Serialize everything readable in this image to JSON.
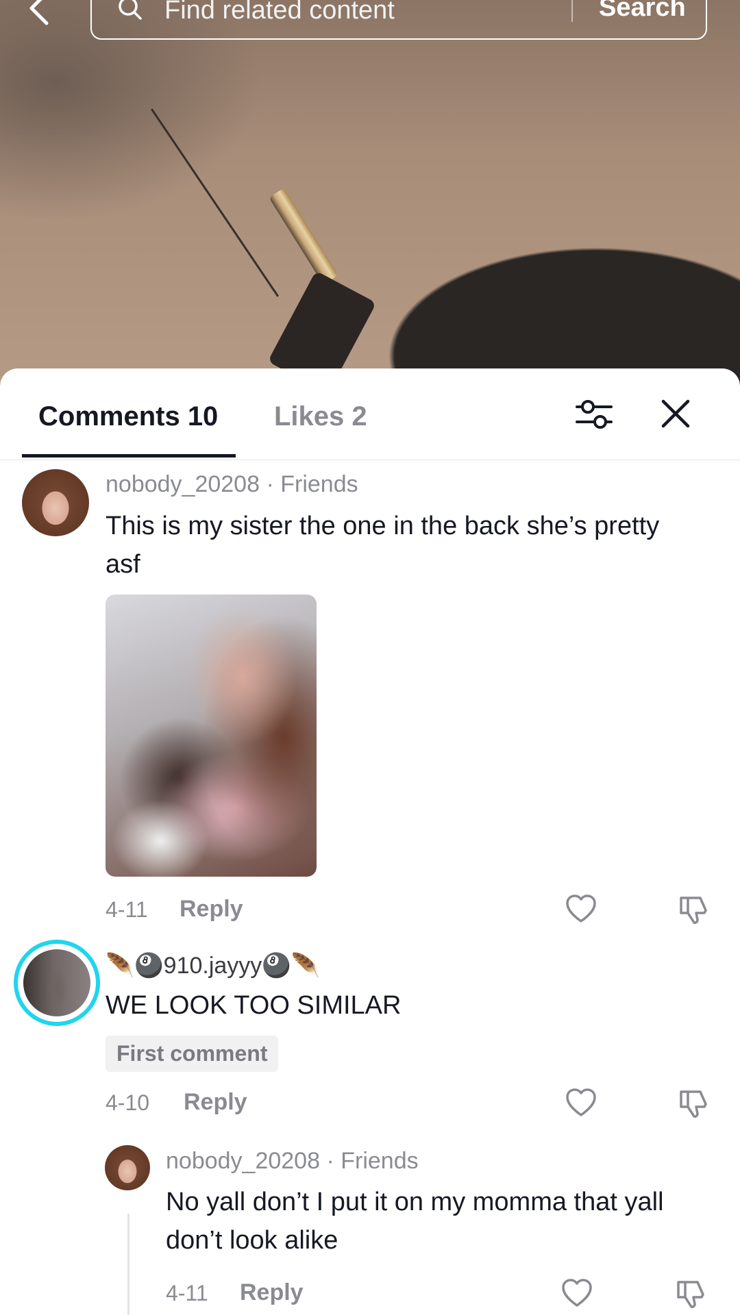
{
  "search": {
    "placeholder": "Find related content",
    "button_label": "Search"
  },
  "tabs": {
    "comments_label": "Comments 10",
    "likes_label": "Likes 2"
  },
  "comments": [
    {
      "username": "nobody_20208",
      "relation": "Friends",
      "separator": "·",
      "text": "This is my sister the one in the back she’s pretty asf",
      "has_photo": true,
      "date": "4-11",
      "reply_label": "Reply"
    },
    {
      "username": "🪶🎱910.jayyy🎱🪶",
      "text": "WE LOOK TOO SIMILAR",
      "badge": "First comment",
      "date": "4-10",
      "reply_label": "Reply"
    },
    {
      "username": "nobody_20208",
      "relation": "Friends",
      "separator": "·",
      "text": "No yall don’t I put it on my momma that yall don’t look alike",
      "date": "4-11",
      "reply_label": "Reply",
      "is_reply": true
    }
  ],
  "colors": {
    "accent_ring": "#20d5ec",
    "text_primary": "#161823",
    "text_secondary": "#8a8b91"
  },
  "icons": [
    "back-icon",
    "search-icon",
    "filter-icon",
    "close-icon",
    "heart-icon",
    "dislike-icon"
  ]
}
